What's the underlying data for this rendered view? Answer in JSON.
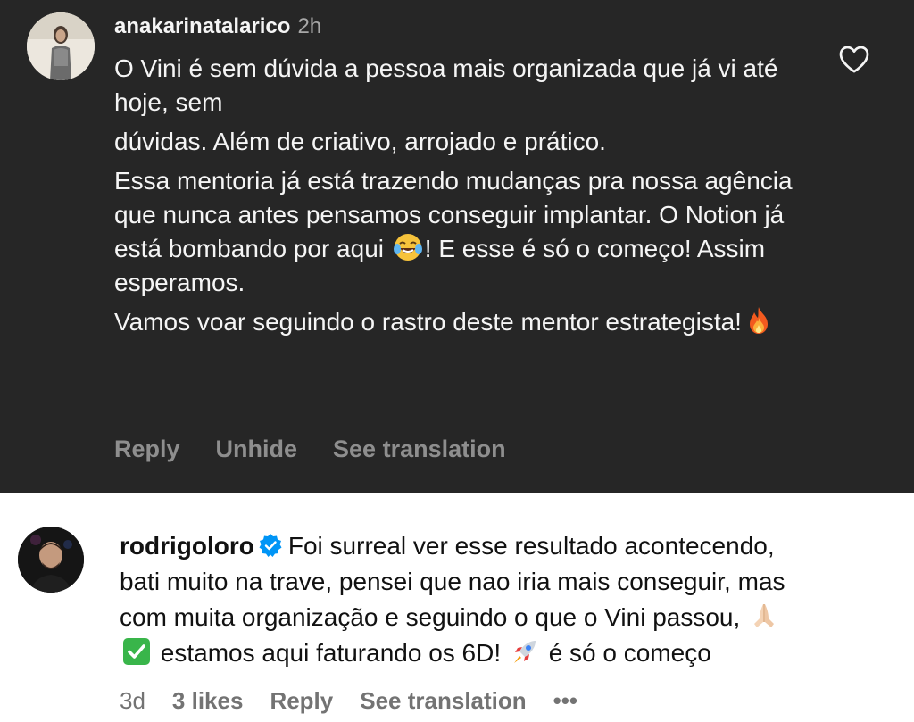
{
  "comment1": {
    "username": "anakarinatalarico",
    "time": "2h",
    "paragraphs": [
      "O Vini é sem dúvida a pessoa mais organizada que já vi até hoje, sem",
      "dúvidas. Além de criativo, arrojado e prático.",
      "Essa mentoria já está trazendo mudanças pra nossa agência que nunca antes pensamos conseguir implantar. O Notion já está bombando por aqui",
      "! E esse é só o começo! Assim esperamos.",
      "Vamos voar seguindo o rastro deste mentor estrategista!"
    ],
    "actions": {
      "reply": "Reply",
      "unhide": "Unhide",
      "see_translation": "See translation"
    },
    "icons": [
      "heart-icon",
      "laughing-crying-emoji",
      "fire-emoji"
    ]
  },
  "comment2": {
    "username": "rodrigoloro",
    "text_line1": "Foi surreal ver esse resultado acontecendo,",
    "text_line2": "bati muito na trave, pensei que nao iria mais conseguir, mas",
    "text_line3": "com muita organização e seguindo o que o Vini passou,",
    "text_line4a": "estamos aqui faturando os 6D!",
    "text_line4b": "é só o começo",
    "meta": {
      "time": "3d",
      "likes": "3 likes",
      "reply": "Reply",
      "see_translation": "See translation",
      "more": "•••"
    },
    "icons": [
      "verified-badge-icon",
      "praying-hands-emoji",
      "check-mark-emoji",
      "rocket-emoji"
    ]
  },
  "colors": {
    "dark_bg": "#262626",
    "dark_text": "#f5f5f5",
    "dark_muted": "#8e8e8e",
    "verified_blue": "#0095f6",
    "light_muted": "#737373"
  }
}
